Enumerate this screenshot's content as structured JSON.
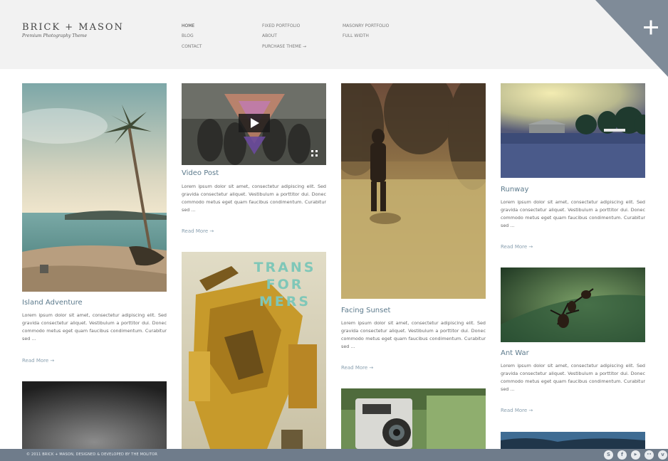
{
  "brand": {
    "title": "Brick + Mason",
    "tagline": "Premium Photography Theme"
  },
  "nav": {
    "home": "Home",
    "blog": "Blog",
    "contact": "Contact",
    "fixed_portfolio": "Fixed Portfolio",
    "about": "About",
    "purchase_theme": "Purchase Theme →",
    "masonry_portfolio": "Masonry Portfolio",
    "full_width": "Full Width"
  },
  "header_action": {
    "icon": "plus-icon"
  },
  "posts": [
    {
      "title": "Island Adventure",
      "excerpt": "Lorem ipsum dolor sit amet, consectetur adipiscing elit. Sed gravida consectetur aliquet. Vestibulum a porttitor dui. Donec commodo metus eget quam faucibus condimentum. Curabitur sed ...",
      "read_more": "Read More →"
    },
    {
      "title": "Video Post",
      "excerpt": "Lorem ipsum dolor sit amet, consectetur adipiscing elit. Sed gravida consectetur aliquet. Vestibulum a porttitor dui. Donec commodo metus eget quam faucibus condimentum. Curabitur sed ...",
      "read_more": "Read More →"
    },
    {
      "title": "Facing Sunset",
      "excerpt": "Lorem ipsum dolor sit amet, consectetur adipiscing elit. Sed gravida consectetur aliquet. Vestibulum a porttitor dui. Donec commodo metus eget quam faucibus condimentum. Curabitur sed ...",
      "read_more": "Read More →"
    },
    {
      "title": "Runway",
      "excerpt": "Lorem ipsum dolor sit amet, consectetur adipiscing elit. Sed gravida consectetur aliquet. Vestibulum a porttitor dui. Donec commodo metus eget quam faucibus condimentum. Curabitur sed ...",
      "read_more": "Read More →"
    },
    {
      "title": "Ant War",
      "excerpt": "Lorem ipsum dolor sit amet, consectetur adipiscing elit. Sed gravida consectetur aliquet. Vestibulum a porttitor dui. Donec commodo metus eget quam faucibus condimentum. Curabitur sed ...",
      "read_more": "Read More →"
    }
  ],
  "poster_text": "TRANS FOR MERS",
  "footer": {
    "copyright": "© 2011 Brick + Mason, Designed & Developed by The Molitor",
    "social": [
      {
        "icon": "skype-icon",
        "glyph": "S"
      },
      {
        "icon": "facebook-icon",
        "glyph": "f"
      },
      {
        "icon": "youtube-icon",
        "glyph": "▶"
      },
      {
        "icon": "flickr-icon",
        "glyph": "••"
      },
      {
        "icon": "vimeo-icon",
        "glyph": "v"
      }
    ]
  },
  "colors": {
    "accent": "#5c7a8c",
    "footer_bg": "#6f7c8b",
    "corner_bg": "#7f8b98"
  }
}
